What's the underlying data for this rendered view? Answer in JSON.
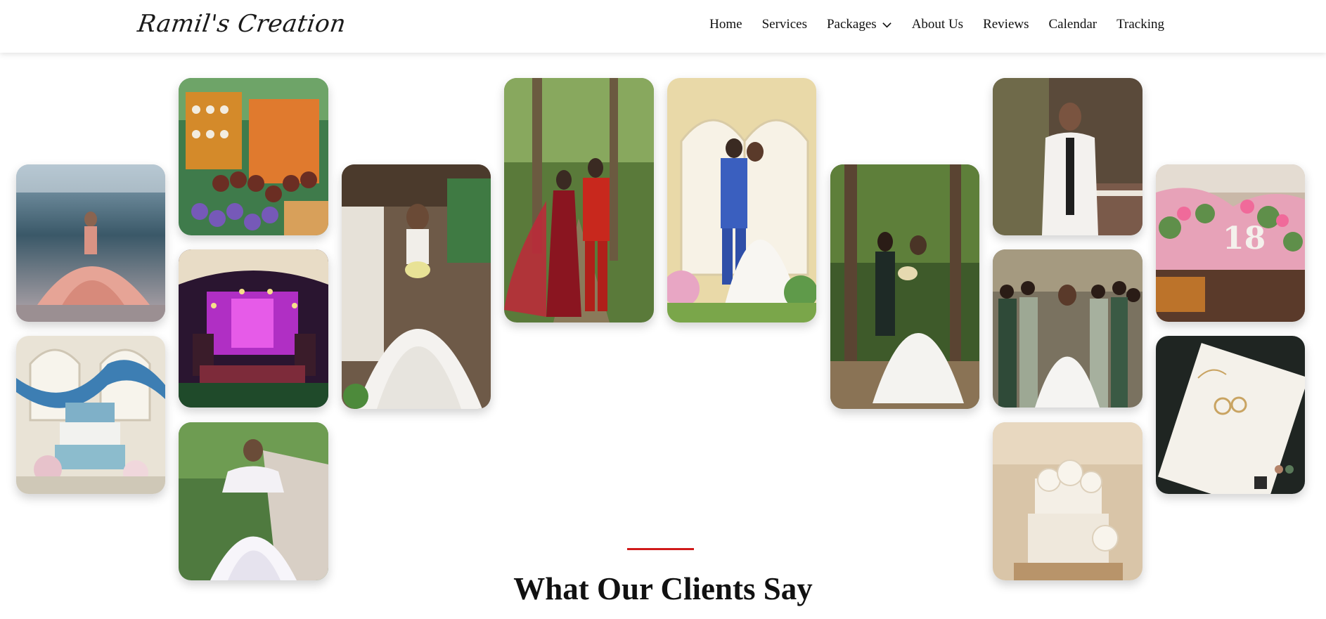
{
  "brand": {
    "name": "Ramil's Creation"
  },
  "nav": {
    "items": [
      {
        "label": "Home"
      },
      {
        "label": "Services"
      },
      {
        "label": "Packages",
        "has_dropdown": true
      },
      {
        "label": "About Us"
      },
      {
        "label": "Reviews"
      },
      {
        "label": "Calendar"
      },
      {
        "label": "Tracking"
      }
    ]
  },
  "gallery": {
    "photos": [
      {
        "subject": "debutante-pink-gown"
      },
      {
        "subject": "wedding-cake-blue-drapes"
      },
      {
        "subject": "cupcake-dessert-table"
      },
      {
        "subject": "purple-lit-reception-hall"
      },
      {
        "subject": "girl-white-puff-dress"
      },
      {
        "subject": "bride-in-white-gown"
      },
      {
        "subject": "couple-in-red-forest"
      },
      {
        "subject": "couple-at-arch-stage"
      },
      {
        "subject": "bride-with-friend-forest"
      },
      {
        "subject": "groom-white-tuxedo"
      },
      {
        "subject": "bride-with-bridesmaids"
      },
      {
        "subject": "white-rose-wedding-cake"
      },
      {
        "subject": "floral-18-stage-backdrop"
      },
      {
        "subject": "wedding-rings-invitation"
      }
    ]
  },
  "testimonials": {
    "title": "What Our Clients Say"
  },
  "colors": {
    "accent": "#d01a1a",
    "text": "#111111",
    "background": "#ffffff"
  }
}
